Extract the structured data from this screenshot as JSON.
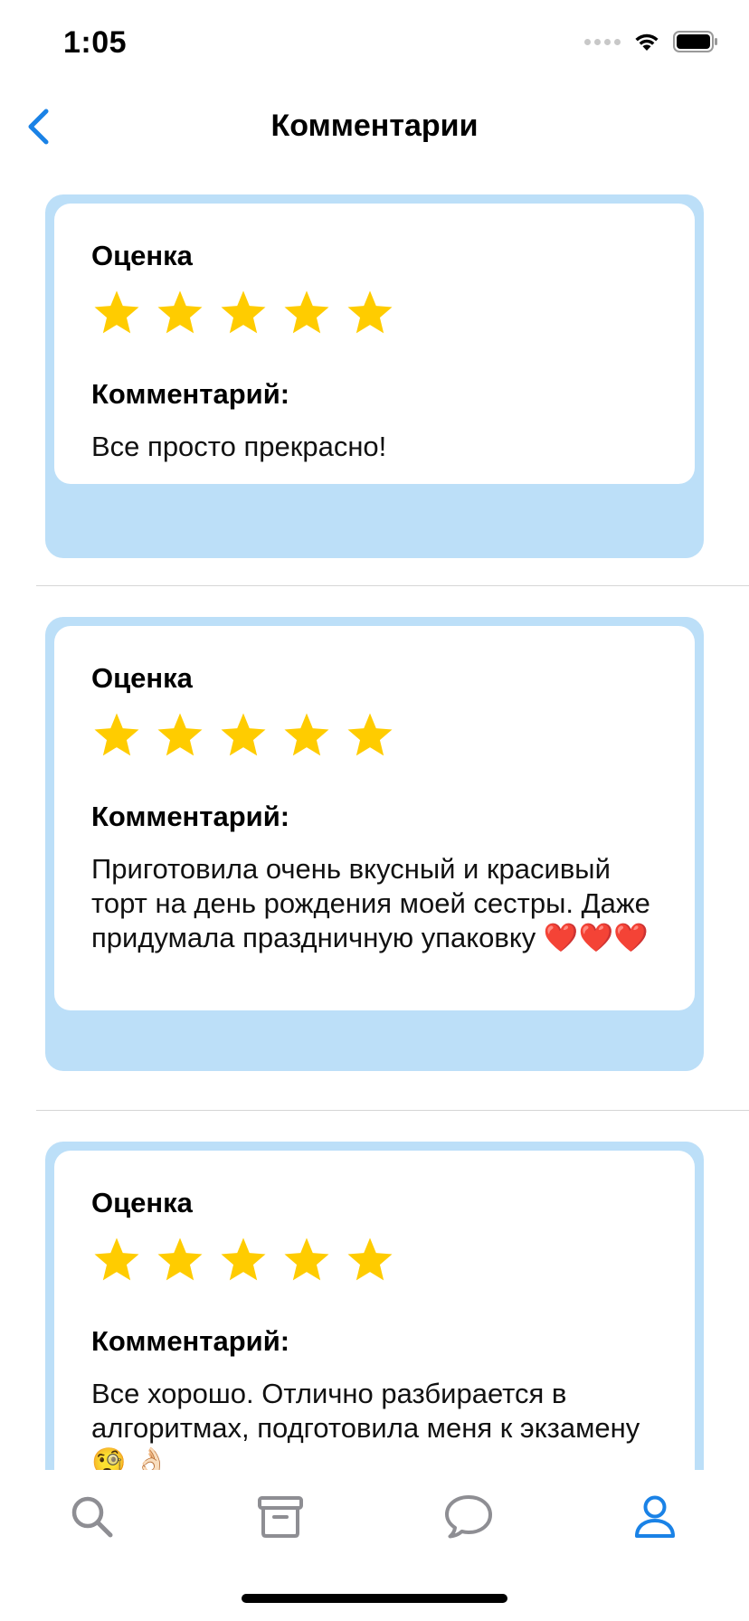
{
  "status_bar": {
    "time": "1:05"
  },
  "nav": {
    "title": "Комментарии",
    "back_icon": "chevron-left-icon"
  },
  "reviews": [
    {
      "rating_label": "Оценка",
      "rating": 5,
      "comment_label": "Комментарий:",
      "comment": "Все просто прекрасно!"
    },
    {
      "rating_label": "Оценка",
      "rating": 5,
      "comment_label": "Комментарий:",
      "comment": "Приготовила очень вкусный и красивый торт на день рождения моей сестры. Даже придумала праздничную упаковку ❤️❤️❤️"
    },
    {
      "rating_label": "Оценка",
      "rating": 5,
      "comment_label": "Комментарий:",
      "comment": "Все хорошо. Отлично разбирается в алгоритмах, подготовила меня к экзамену 🧐 👌🏻"
    }
  ],
  "tab_bar": {
    "tabs": [
      {
        "icon": "search-icon",
        "active": false
      },
      {
        "icon": "archive-icon",
        "active": false
      },
      {
        "icon": "chat-bubble-icon",
        "active": false
      },
      {
        "icon": "profile-icon",
        "active": true
      }
    ]
  },
  "colors": {
    "accent": "#1a82e6",
    "card_background": "#bcdff8",
    "star": "#ffcc00",
    "inactive_icon": "#8e8e93"
  }
}
